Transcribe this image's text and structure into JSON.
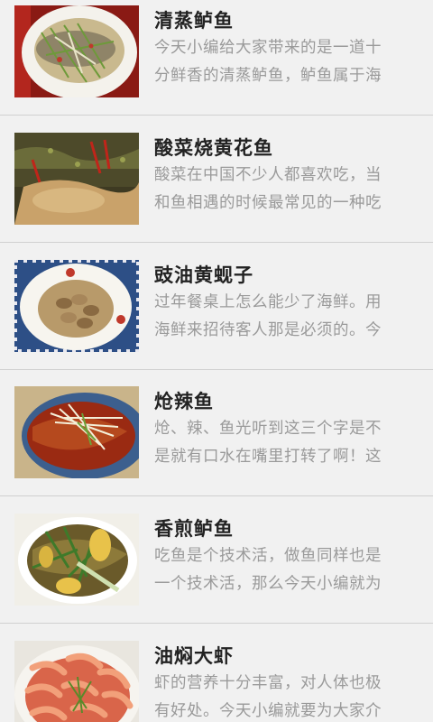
{
  "recipes": [
    {
      "title": "清蒸鲈鱼",
      "desc_line1": "今天小编给大家带来的是一道十",
      "desc_line2": "分鲜香的清蒸鲈鱼，鲈鱼属于海",
      "image": "steamed-sea-bass-image"
    },
    {
      "title": "酸菜烧黄花鱼",
      "desc_line1": "酸菜在中国不少人都喜欢吃，当",
      "desc_line2": "和鱼相遇的时候最常见的一种吃",
      "image": "pickled-cabbage-yellow-croaker-image"
    },
    {
      "title": "豉油黄蚬子",
      "desc_line1": "过年餐桌上怎么能少了海鲜。用",
      "desc_line2": "海鲜来招待客人那是必须的。今",
      "image": "soy-clams-image"
    },
    {
      "title": "炝辣鱼",
      "desc_line1": "炝、辣、鱼光听到这三个字是不",
      "desc_line2": "是就有口水在嘴里打转了啊！这",
      "image": "spicy-fish-image"
    },
    {
      "title": "香煎鲈鱼",
      "desc_line1": "吃鱼是个技术活，做鱼同样也是",
      "desc_line2": "一个技术活，那么今天小编就为",
      "image": "pan-fried-sea-bass-image"
    },
    {
      "title": "油焖大虾",
      "desc_line1": "虾的营养十分丰富，对人体也极",
      "desc_line2": "有好处。今天小编就要为大家介",
      "image": "braised-prawns-image"
    }
  ]
}
